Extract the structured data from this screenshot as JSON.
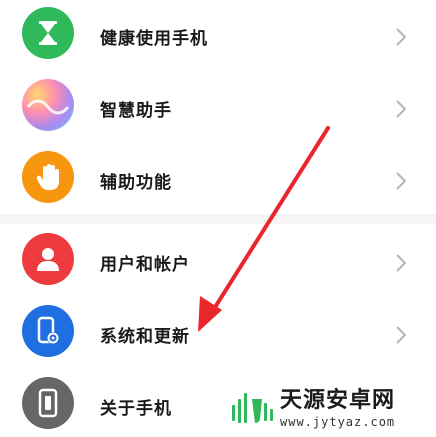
{
  "settings_list": {
    "items": [
      {
        "label": "健康使用手机",
        "icon": "hourglass-icon",
        "icon_color": "#2fb95a"
      },
      {
        "label": "智慧助手",
        "icon": "smart-assistant-icon",
        "icon_color": "#9b7ee8"
      },
      {
        "label": "辅助功能",
        "icon": "hand-icon",
        "icon_color": "#f6950e"
      },
      {
        "label": "用户和帐户",
        "icon": "user-icon",
        "icon_color": "#ee3b3d"
      },
      {
        "label": "系统和更新",
        "icon": "phone-settings-icon",
        "icon_color": "#1f6fe0"
      },
      {
        "label": "关于手机",
        "icon": "phone-icon",
        "icon_color": "#666666"
      }
    ]
  },
  "annotation": {
    "arrow_color": "#e8262b"
  },
  "watermark": {
    "title": "天源安卓网",
    "url": "www.jytyaz.com",
    "logo_color": "#2fb95a"
  }
}
